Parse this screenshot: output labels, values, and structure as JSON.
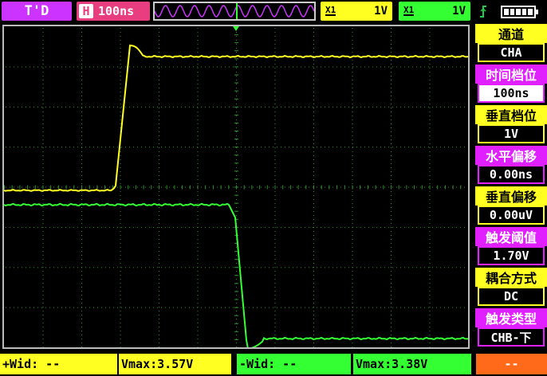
{
  "topbar": {
    "trigger_mode": "T'D",
    "time_prefix": "H",
    "time_base": "100ns",
    "ch1": {
      "probe": "X1",
      "volts": "1V"
    },
    "ch2": {
      "probe": "X1",
      "volts": "1V"
    },
    "trigger_icon": "trigger-edge-icon",
    "battery_icon": "battery-icon",
    "battery_level": 1.0
  },
  "panel": [
    {
      "label": "通道",
      "value": "CHA"
    },
    {
      "label": "时间档位",
      "value": "100ns"
    },
    {
      "label": "垂直档位",
      "value": "1V"
    },
    {
      "label": "水平偏移",
      "value": "0.00ns"
    },
    {
      "label": "垂直偏移",
      "value": "0.00uV"
    },
    {
      "label": "触发阈值",
      "value": "1.70V"
    },
    {
      "label": "耦合方式",
      "value": "DC"
    },
    {
      "label": "触发类型",
      "value": "CHB-下"
    }
  ],
  "bottom": {
    "ch1_width": "+Wid: --",
    "ch1_vmax": "Vmax:3.57V",
    "ch2_width": "-Wid: --",
    "ch2_vmax": "Vmax:3.38V",
    "extra": "--"
  },
  "colors": {
    "ch1": "#ffff22",
    "ch2": "#33ff33",
    "accent_pink": "#e020ff",
    "grid": "#2f8f2f"
  }
}
